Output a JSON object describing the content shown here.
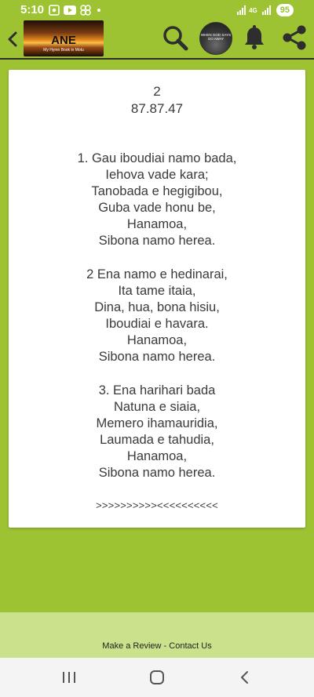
{
  "status_bar": {
    "time": "5:10",
    "battery": "95",
    "network": "4G"
  },
  "app_bar": {
    "logo_title": "ANE",
    "logo_subtitle": "My Hymn Book in Motu",
    "avatar_text": "WHEN GOD\nSAYS GO AWAY",
    "icons": [
      "back-icon",
      "search-icon",
      "bell-icon",
      "share-icon"
    ]
  },
  "hymn": {
    "number": "2",
    "meter": "87.87.47",
    "verses": [
      [
        "1. Gau iboudiai namo bada,",
        "Iehova vade kara;",
        "Tanobada e hegigibou,",
        "Guba vade honu be,",
        "Hanamoa,",
        "Sibona namo herea."
      ],
      [
        "2 Ena namo e hedinarai,",
        "Ita tame itaia,",
        "Dina, hua, bona hisiu,",
        "Iboudiai e havara.",
        "Hanamoa,",
        "Sibona namo herea."
      ],
      [
        "3. Ena harihari bada",
        "Natuna e siaia,",
        "Memero ihamauridia,",
        "Laumada e tahudia,",
        "Hanamoa,",
        "Sibona namo herea."
      ]
    ],
    "end_marker": ">>>>>>>>>><<<<<<<<<<"
  },
  "footer": {
    "review_label": "Make a Review",
    "separator": " - ",
    "contact_label": "Contact Us"
  },
  "colors": {
    "background": "#9dc332",
    "footer": "#cbe28d",
    "card": "#ffffff"
  }
}
